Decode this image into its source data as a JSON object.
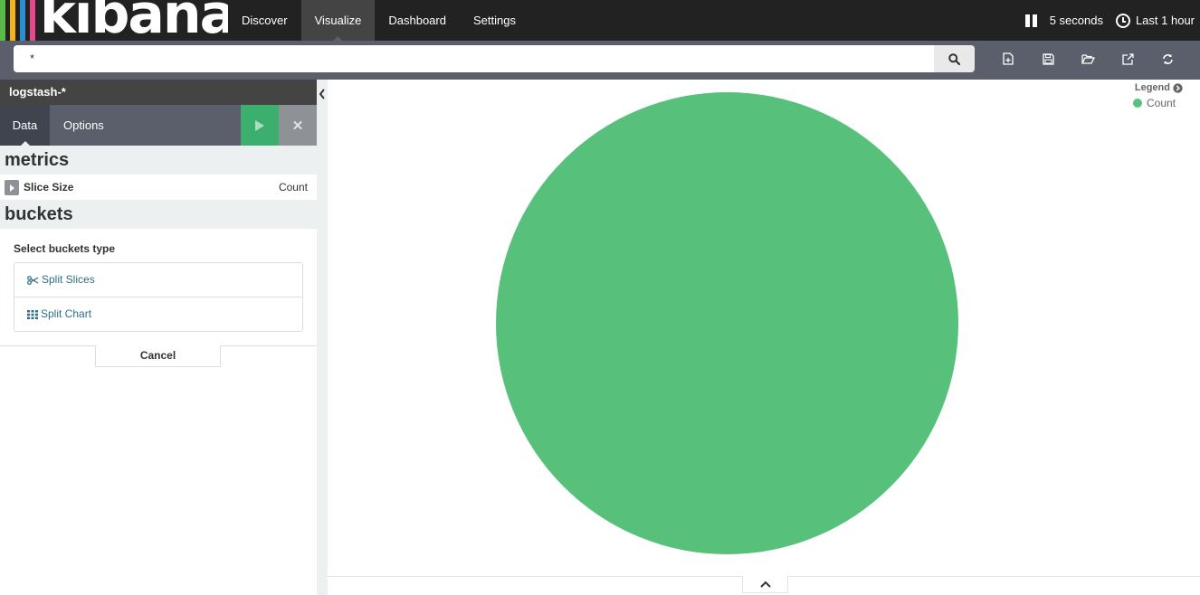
{
  "app": {
    "logo_text": "kibana",
    "logo_bar_colors": [
      "#5ab947",
      "#f2b31b",
      "#2d8ecf",
      "#e8478b"
    ]
  },
  "nav": {
    "links": [
      {
        "label": "Discover"
      },
      {
        "label": "Visualize"
      },
      {
        "label": "Dashboard"
      },
      {
        "label": "Settings"
      }
    ],
    "active": "Visualize",
    "refresh_interval": "5 seconds",
    "time_range": "Last 1 hour"
  },
  "search": {
    "query": "*"
  },
  "toolbar": {
    "icons": [
      "new-visualization-icon",
      "save-icon",
      "open-icon",
      "share-icon",
      "refresh-icon"
    ]
  },
  "sidebar": {
    "index_pattern": "logstash-*",
    "tabs": {
      "data": "Data",
      "options": "Options"
    },
    "metrics": {
      "heading": "metrics",
      "aggregation": {
        "name": "Slice Size",
        "value": "Count"
      }
    },
    "buckets": {
      "heading": "buckets",
      "select_label": "Select buckets type",
      "types": [
        {
          "label": "Split Slices",
          "icon": "scissors-icon"
        },
        {
          "label": "Split Chart",
          "icon": "grid-icon"
        }
      ],
      "cancel_label": "Cancel"
    }
  },
  "chart_data": {
    "type": "pie",
    "categories": [
      "Count"
    ],
    "values": [
      100
    ],
    "colors": [
      "#57c17b"
    ],
    "legend": {
      "title": "Legend",
      "placement": "top-right",
      "entries": [
        "Count"
      ]
    }
  },
  "colors": {
    "accent": "#3caf6f",
    "nav_bg": "#222222",
    "toolbar_bg": "#5a5f6b"
  }
}
